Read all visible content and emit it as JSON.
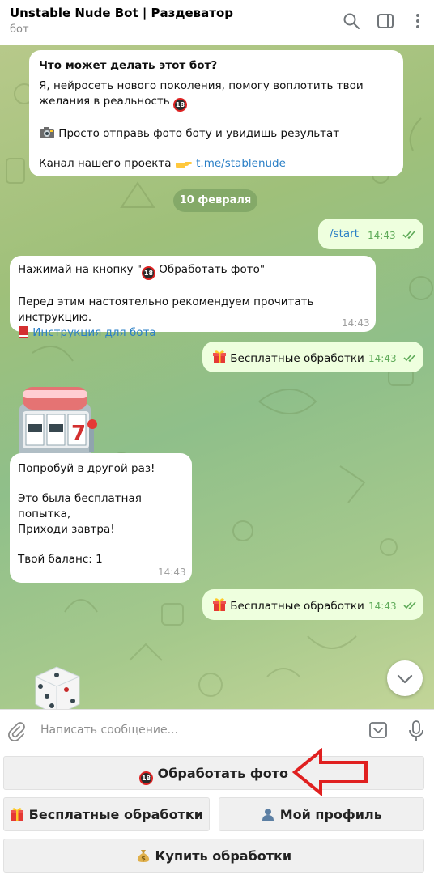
{
  "header": {
    "title": "Unstable Nude Bot | Раздеватор",
    "subtitle": "бот",
    "icons": [
      "search-icon",
      "sidebar-toggle-icon",
      "more-icon"
    ]
  },
  "info_card": {
    "heading": "Что может делать этот бот?",
    "line1": "Я, нейросеть нового поколения, помогу воплотить твои",
    "line2": "желания в реальность",
    "line3": "Просто отправь фото боту и увидишь результат",
    "line4_prefix": "Канал нашего проекта",
    "link": "t.me/stablenude"
  },
  "date_separator": "10 февраля",
  "messages": {
    "start": {
      "text": "/start",
      "time": "14:43"
    },
    "instruction": {
      "line1_a": "Нажимай на кнопку \"",
      "line1_b": " Обработать фото\"",
      "line2": "Перед этим настоятельно рекомендуем прочитать инструкцию.",
      "link": "Инструкция для бота",
      "time": "14:43"
    },
    "free1": {
      "text": "Бесплатные обработки",
      "time": "14:43"
    },
    "retry": {
      "line1": "Попробуй в другой раз!",
      "line2": "Это была бесплатная попытка,",
      "line3": "Приходи завтра!",
      "line4": "Твой баланс: 1",
      "time": "14:43"
    },
    "free2": {
      "text": "Бесплатные обработки",
      "time": "14:43"
    }
  },
  "composer": {
    "placeholder": "Написать сообщение..."
  },
  "keyboard": {
    "process": "Обработать фото",
    "free": "Бесплатные обработки",
    "profile": "Мой профиль",
    "buy": "Купить обработки"
  },
  "emoji_badge": "18",
  "colors": {
    "link": "#2a7fc6",
    "outgoing_bubble": "#eeffde",
    "read_checks": "#5fab59",
    "annotation_arrow": "#e02020"
  }
}
